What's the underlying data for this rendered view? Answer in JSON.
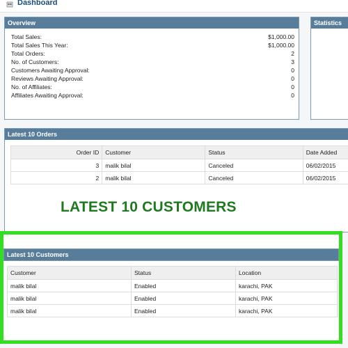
{
  "header": {
    "title": "Dashboard",
    "icon": "home-icon"
  },
  "overview": {
    "title": "Overview",
    "rows": [
      {
        "label": "Total Sales:",
        "value": "$1,000.00"
      },
      {
        "label": "Total Sales This Year:",
        "value": "$1,000.00"
      },
      {
        "label": "Total Orders:",
        "value": "2"
      },
      {
        "label": "No. of Customers:",
        "value": "3"
      },
      {
        "label": "Customers Awaiting Approval:",
        "value": "0"
      },
      {
        "label": "Reviews Awaiting Approval:",
        "value": "0"
      },
      {
        "label": "No. of Affiliates:",
        "value": "0"
      },
      {
        "label": "Affiliates Awaiting Approval:",
        "value": "0"
      }
    ]
  },
  "statistics": {
    "title": "Statistics"
  },
  "orders": {
    "title": "Latest 10 Orders",
    "columns": [
      "Order ID",
      "Customer",
      "Status",
      "Date Added"
    ],
    "rows": [
      {
        "order_id": "3",
        "customer": "malik bilal",
        "status": "Canceled",
        "date": "06/02/2015"
      },
      {
        "order_id": "2",
        "customer": "malik bilal",
        "status": "Canceled",
        "date": "06/02/2015"
      }
    ]
  },
  "annotation": {
    "text": "LATEST 10 CUSTOMERS",
    "color": "#1f7a1f",
    "frame_color": "#33dd22"
  },
  "customers": {
    "title": "Latest 10 Customers",
    "columns": [
      "Customer",
      "Status",
      "Location"
    ],
    "rows": [
      {
        "customer": "malik bilal",
        "status": "Enabled",
        "location": "karachi, PAK"
      },
      {
        "customer": "malik bilal",
        "status": "Enabled",
        "location": "karachi, PAK"
      },
      {
        "customer": "malik bilal",
        "status": "Enabled",
        "location": "karachi, PAK"
      }
    ]
  },
  "colors": {
    "box_header": "#587d9a",
    "box_border": "#7c99b3",
    "accent_title": "#1a4a7a"
  }
}
